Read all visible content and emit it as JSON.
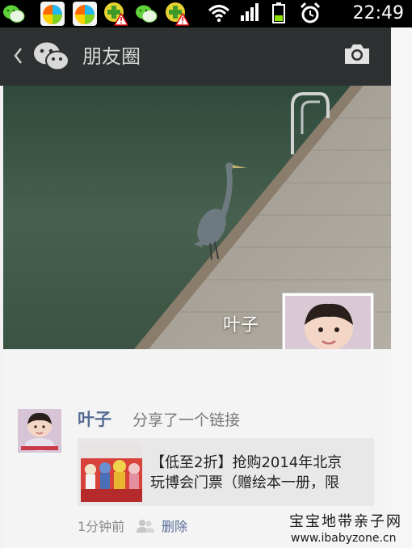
{
  "status_bar": {
    "time": "22:49",
    "notification_icons": [
      "wechat-icon",
      "app-store-icon",
      "app-store-icon",
      "plus-warning-icon",
      "wechat-icon",
      "plus-warning-icon"
    ],
    "system_icons": [
      "wifi-icon",
      "signal-icon",
      "battery-icon",
      "alarm-icon"
    ]
  },
  "header": {
    "title": "朋友圈",
    "back_icon": "chevron-left-icon",
    "app_icon": "wechat-icon",
    "action_icon": "camera-icon"
  },
  "cover": {
    "user_name": "叶子",
    "image": "heron-on-dock"
  },
  "post": {
    "user_name": "叶子",
    "action_text": "分享了一个链接",
    "link": {
      "line1": "【低至2折】抢购2014年北京",
      "line2": "玩博会门票（赠绘本一册，限"
    },
    "time": "1分钟前",
    "privacy_icon": "friends-icon",
    "delete_label": "删除"
  },
  "watermark": {
    "line1": "宝宝地带亲子网",
    "line2": "www.ibabyzone.cn"
  },
  "colors": {
    "header_bg": "#2e3132",
    "link_blue": "#576b95",
    "feed_bg": "#f4f4f4"
  }
}
